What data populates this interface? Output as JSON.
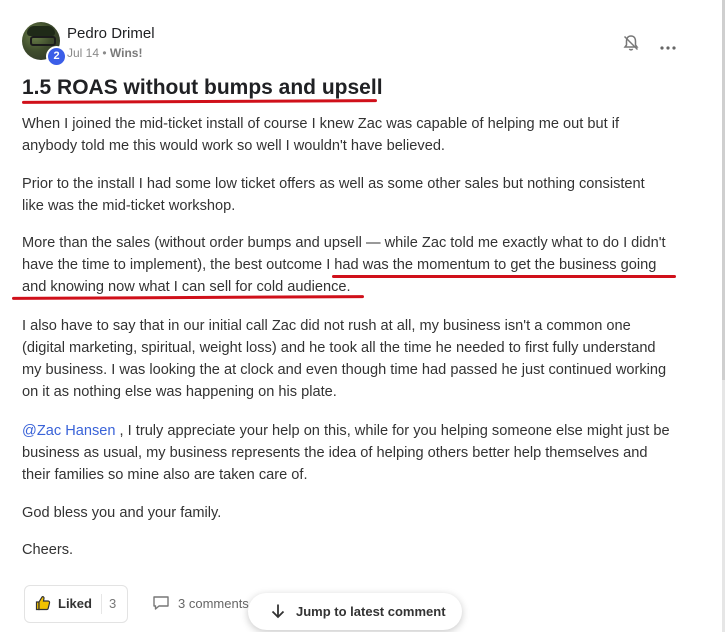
{
  "post": {
    "author": "Pedro Drimel",
    "level": "2",
    "date": "Jul 14",
    "separator": " • ",
    "category": "Wins!",
    "title": "1.5 ROAS without bumps and upsell",
    "paragraphs": {
      "p1": {
        "l1": "When I joined the mid-ticket install of course I knew Zac was capable of helping me out but if",
        "l2": "anybody told me this would work so well I wouldn't have believed."
      },
      "p2": {
        "l1": "Prior to the install I had some low ticket offers as well as some other sales but nothing consistent",
        "l2": "like was the mid-ticket workshop."
      },
      "p3": {
        "l1": "More than the sales (without order bumps and upsell — while Zac told me exactly what to do I didn't",
        "l2": "have the time to implement), the best outcome I had was the momentum to get the business going",
        "l3": "and knowing now what I can sell for cold audience."
      },
      "p4": {
        "l1": "I also have to say that in our initial call Zac did not rush at all, my business isn't a common one",
        "l2": "(digital marketing, spiritual, weight loss) and he took all the time he needed to first fully understand",
        "l3": "my business. I was looking the at clock and even though time had passed he just continued working",
        "l4": "on it as nothing else was happening on his plate."
      },
      "p5": {
        "mention": "@Zac Hansen",
        "l1_rest": " , I truly appreciate your help on this, while for you helping someone else might just be",
        "l2": "business as usual, my business represents the idea of helping others better help themselves and",
        "l3": "their families so mine also are taken care of."
      },
      "p6": "God bless you and your family.",
      "p7": "Cheers."
    }
  },
  "actions": {
    "liked_label": "Liked",
    "like_count": "3",
    "comments_label": "3 comments",
    "jump_label": "Jump to latest comment"
  },
  "icons": {
    "bell": "bell-off-icon",
    "more": "more-horizontal-icon",
    "like": "thumbs-up-icon",
    "comment": "comment-icon",
    "jump": "arrow-down-icon"
  },
  "colors": {
    "underline": "#d0101a",
    "mention": "#3a63d8",
    "badge": "#3b5ee8"
  }
}
